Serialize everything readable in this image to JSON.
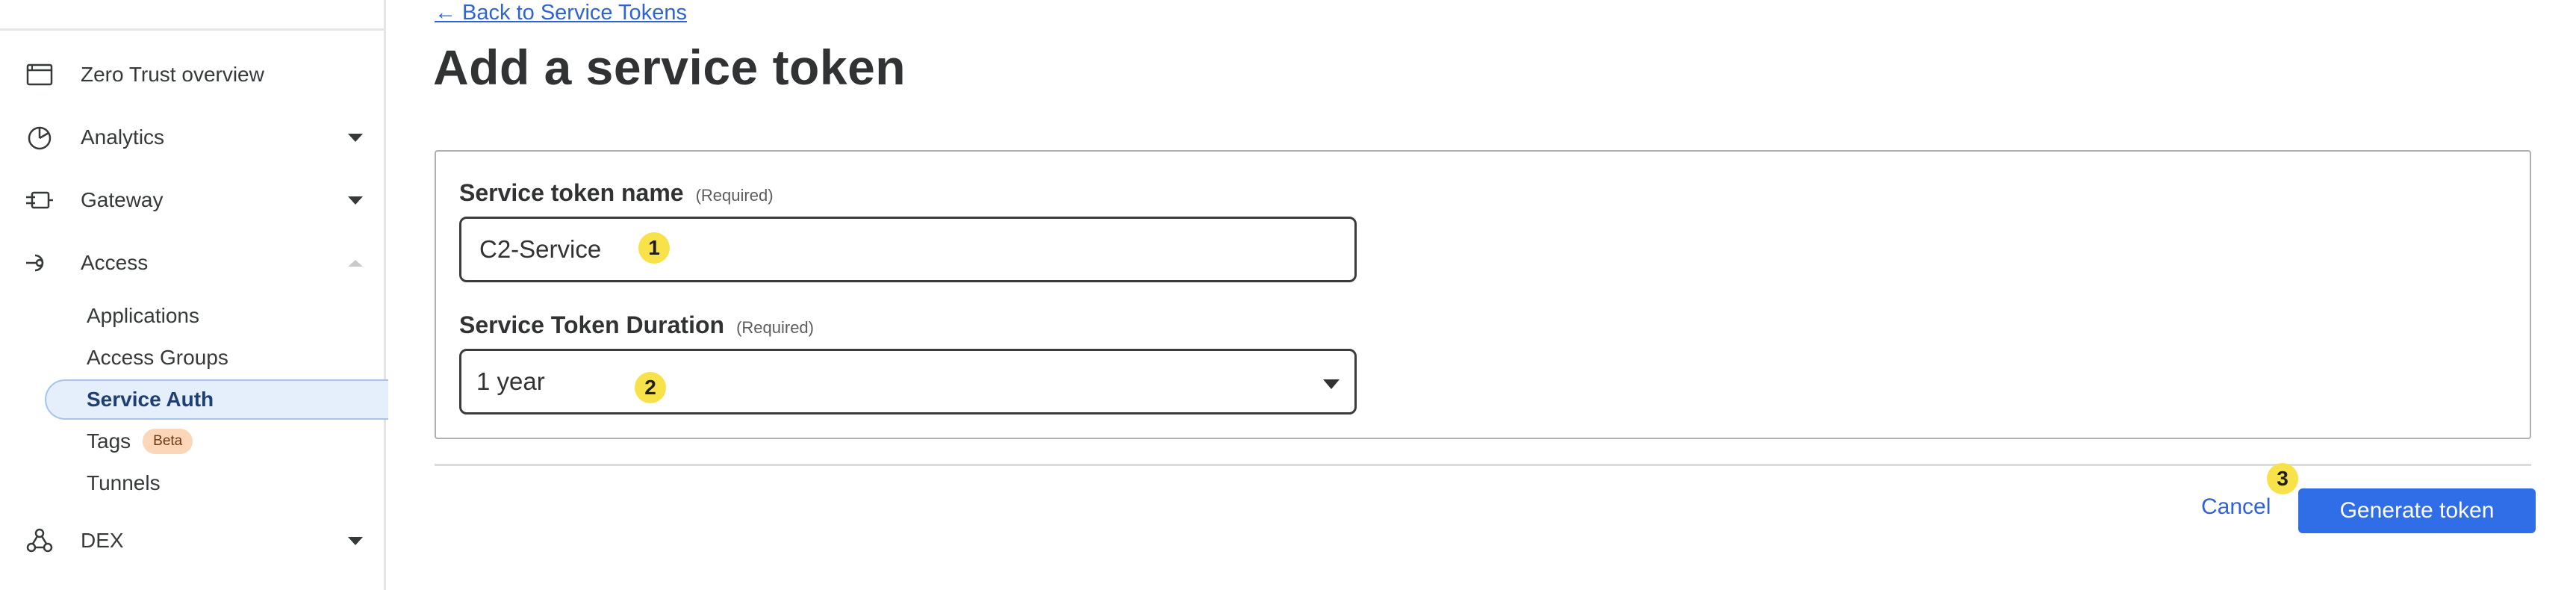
{
  "sidebar": {
    "items": [
      {
        "label": "Zero Trust overview",
        "icon": "browser-window-icon"
      },
      {
        "label": "Analytics",
        "icon": "pie-chart-icon"
      },
      {
        "label": "Gateway",
        "icon": "gateway-icon"
      },
      {
        "label": "Access",
        "icon": "access-icon"
      },
      {
        "label": "DEX",
        "icon": "dex-network-icon"
      }
    ],
    "access_subitems": [
      {
        "label": "Applications"
      },
      {
        "label": "Access Groups"
      },
      {
        "label": "Service Auth",
        "active": true
      },
      {
        "label": "Tags",
        "badge": "Beta"
      },
      {
        "label": "Tunnels"
      }
    ]
  },
  "main": {
    "back_link": "← Back to Service Tokens",
    "title": "Add a service token",
    "form": {
      "name_label": "Service token name",
      "name_required": "(Required)",
      "name_value": "C2-Service",
      "duration_label": "Service Token Duration",
      "duration_required": "(Required)",
      "duration_value": "1 year"
    },
    "badges": [
      "1",
      "2",
      "3"
    ],
    "cancel_label": "Cancel",
    "generate_label": "Generate token"
  },
  "colors": {
    "accent": "#2f6ee7",
    "link": "#2f63d4",
    "active_bg": "#e5eefb",
    "step_badge": "#f7e24a",
    "beta_badge": "#fbd6b8"
  }
}
